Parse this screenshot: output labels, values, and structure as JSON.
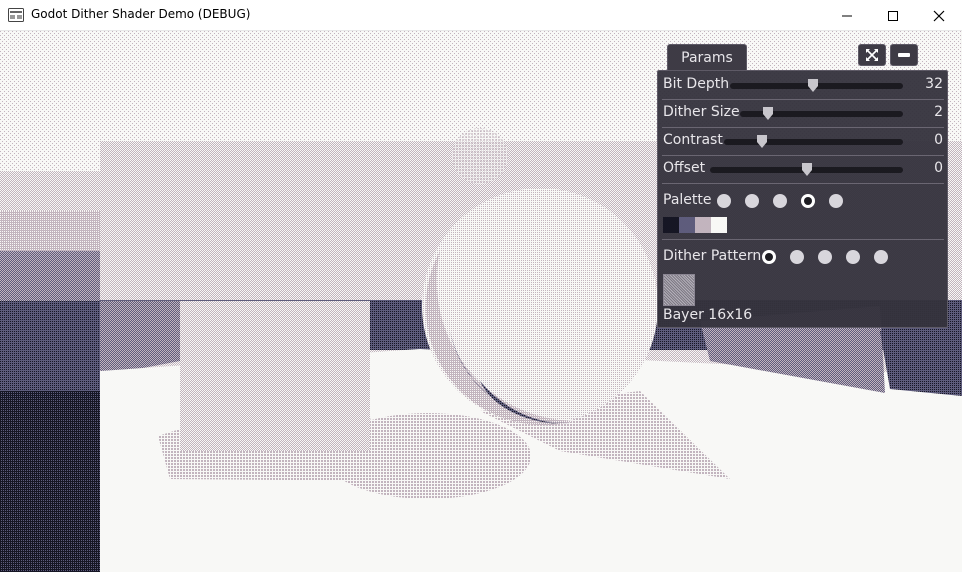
{
  "window": {
    "title": "Godot Dither Shader Demo (DEBUG)"
  },
  "params": {
    "tab_label": "Params",
    "sliders": [
      {
        "label": "Bit Depth",
        "value": "32",
        "level": 0.48
      },
      {
        "label": "Dither Size",
        "value": "2",
        "level": 0.17
      },
      {
        "label": "Contrast",
        "value": "0",
        "level": 0.21
      },
      {
        "label": "Offset",
        "value": "0",
        "level": 0.5
      }
    ],
    "palette": {
      "label": "Palette",
      "options_count": 5,
      "selected_index": 3,
      "colors": [
        "#161624",
        "#5e5c7c",
        "#c2b4be",
        "#f8f8f6"
      ]
    },
    "dither_pattern": {
      "label": "Dither Pattern",
      "options_count": 5,
      "selected_index": 0,
      "name": "Bayer 16x16"
    }
  }
}
